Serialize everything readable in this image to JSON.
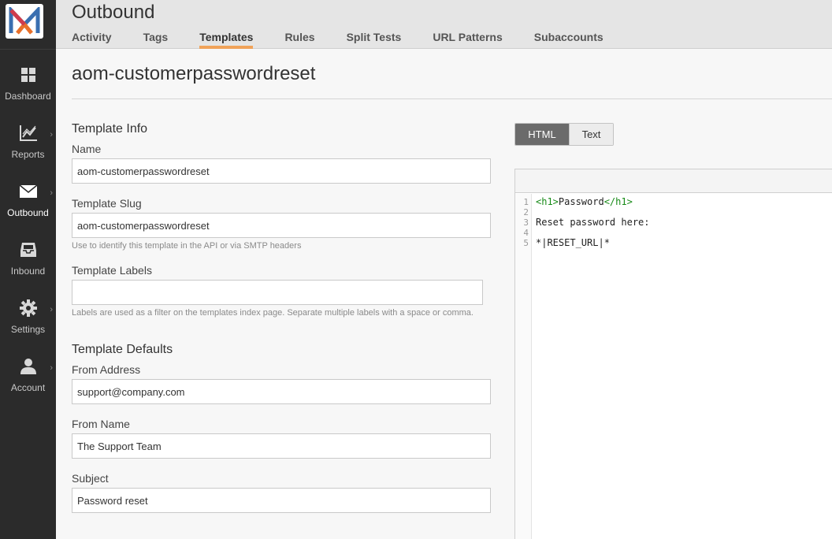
{
  "app": {
    "title": "Outbound",
    "logo_letter": "M"
  },
  "tabs": [
    {
      "label": "Activity"
    },
    {
      "label": "Tags"
    },
    {
      "label": "Templates",
      "active": true
    },
    {
      "label": "Rules"
    },
    {
      "label": "Split Tests"
    },
    {
      "label": "URL Patterns"
    },
    {
      "label": "Subaccounts"
    }
  ],
  "sidebar": {
    "items": [
      {
        "label": "Dashboard",
        "icon": "grid-icon"
      },
      {
        "label": "Reports",
        "icon": "chart-icon",
        "has_submenu": true
      },
      {
        "label": "Outbound",
        "icon": "envelope-icon",
        "has_submenu": true,
        "active": true
      },
      {
        "label": "Inbound",
        "icon": "inbox-icon"
      },
      {
        "label": "Settings",
        "icon": "gear-icon",
        "has_submenu": true
      },
      {
        "label": "Account",
        "icon": "user-icon",
        "has_submenu": true
      }
    ]
  },
  "page": {
    "title": "aom-customerpasswordreset"
  },
  "template_info": {
    "heading": "Template Info",
    "name_label": "Name",
    "name_value": "aom-customerpasswordreset",
    "slug_label": "Template Slug",
    "slug_value": "aom-customerpasswordreset",
    "slug_help": "Use to identify this template in the API or via SMTP headers",
    "labels_label": "Template Labels",
    "labels_value": "",
    "labels_help": "Labels are used as a filter on the templates index page. Separate multiple labels with a space or comma."
  },
  "template_defaults": {
    "heading": "Template Defaults",
    "from_address_label": "From Address",
    "from_address_value": "support@company.com",
    "from_name_label": "From Name",
    "from_name_value": "The Support Team",
    "subject_label": "Subject",
    "subject_value": "Password reset"
  },
  "editor": {
    "mode_html": "HTML",
    "mode_text": "Text",
    "active_mode": "HTML",
    "line_numbers": [
      "1",
      "2",
      "3",
      "4",
      "5"
    ],
    "lines": {
      "l1_open": "<h1>",
      "l1_text": "Password",
      "l1_close": "</h1>",
      "l2": "",
      "l3": "Reset password here:",
      "l4": "",
      "l5": "*|RESET_URL|*"
    }
  },
  "colors": {
    "sidebar_bg": "#2b2b2b",
    "tab_underline": "#f0a35a",
    "code_tag": "#178a17"
  }
}
